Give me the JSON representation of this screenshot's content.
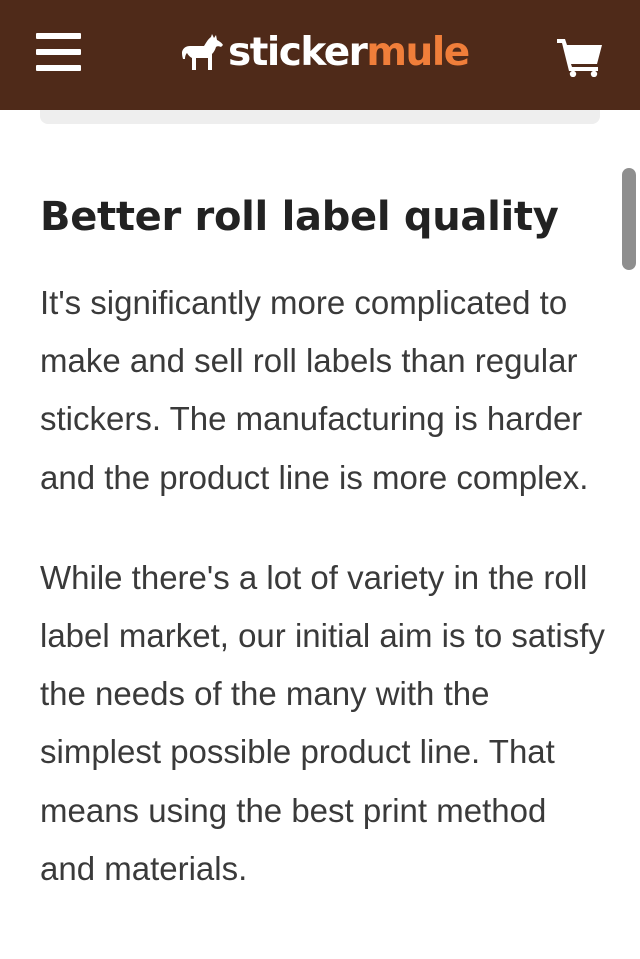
{
  "header": {
    "logo": {
      "word1": "sticker",
      "word2": "mule"
    },
    "colors": {
      "background": "#4f2a19",
      "logo_accent": "#f07e3a",
      "logo_primary": "#ffffff"
    },
    "icons": {
      "menu": "hamburger-menu-icon",
      "logo": "mule-icon",
      "cart": "shopping-cart-icon"
    }
  },
  "article": {
    "heading": "Better roll label quality",
    "paragraphs": [
      "It's significantly more complicated to make and sell roll labels than regular stickers. The manufacturing is harder and the product line is more complex.",
      "While there's a lot of variety in the roll label market, our initial aim is to satisfy the needs of the many with the simplest possible product line. That means using the best print method and materials."
    ]
  }
}
